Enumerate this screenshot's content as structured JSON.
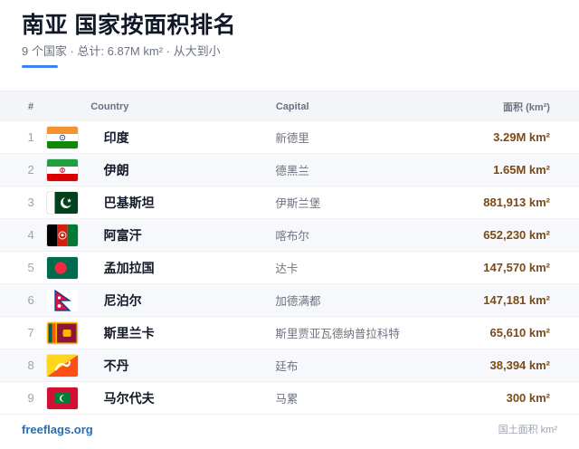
{
  "header": {
    "title": "南亚 国家按面积排名",
    "subtitle": "9 个国家 · 总计: 6.87M km² · 从大到小"
  },
  "table": {
    "columns": {
      "num": "#",
      "country": "Country",
      "capital": "Capital",
      "area": "面积 (km²)"
    },
    "rows": [
      {
        "rank": "1",
        "country": "印度",
        "capital": "新德里",
        "area": "3.29M km²",
        "flag": "india-flag-icon"
      },
      {
        "rank": "2",
        "country": "伊朗",
        "capital": "德黑兰",
        "area": "1.65M km²",
        "flag": "iran-flag-icon"
      },
      {
        "rank": "3",
        "country": "巴基斯坦",
        "capital": "伊斯兰堡",
        "area": "881,913 km²",
        "flag": "pakistan-flag-icon"
      },
      {
        "rank": "4",
        "country": "阿富汗",
        "capital": "喀布尔",
        "area": "652,230 km²",
        "flag": "afghanistan-flag-icon"
      },
      {
        "rank": "5",
        "country": "孟加拉国",
        "capital": "达卡",
        "area": "147,570 km²",
        "flag": "bangladesh-flag-icon"
      },
      {
        "rank": "6",
        "country": "尼泊尔",
        "capital": "加德满都",
        "area": "147,181 km²",
        "flag": "nepal-flag-icon"
      },
      {
        "rank": "7",
        "country": "斯里兰卡",
        "capital": "斯里贾亚瓦德纳普拉科特",
        "area": "65,610 km²",
        "flag": "sri-lanka-flag-icon"
      },
      {
        "rank": "8",
        "country": "不丹",
        "capital": "廷布",
        "area": "38,394 km²",
        "flag": "bhutan-flag-icon"
      },
      {
        "rank": "9",
        "country": "马尔代夫",
        "capital": "马累",
        "area": "300 km²",
        "flag": "maldives-flag-icon"
      }
    ]
  },
  "footer": {
    "link": "freeflags.org",
    "note": "国土面积 km²"
  },
  "colors": {
    "accent": "#3b82f6",
    "area_text": "#7c4a14",
    "header_bg": "#f3f5f8",
    "link": "#2b6cb0"
  }
}
